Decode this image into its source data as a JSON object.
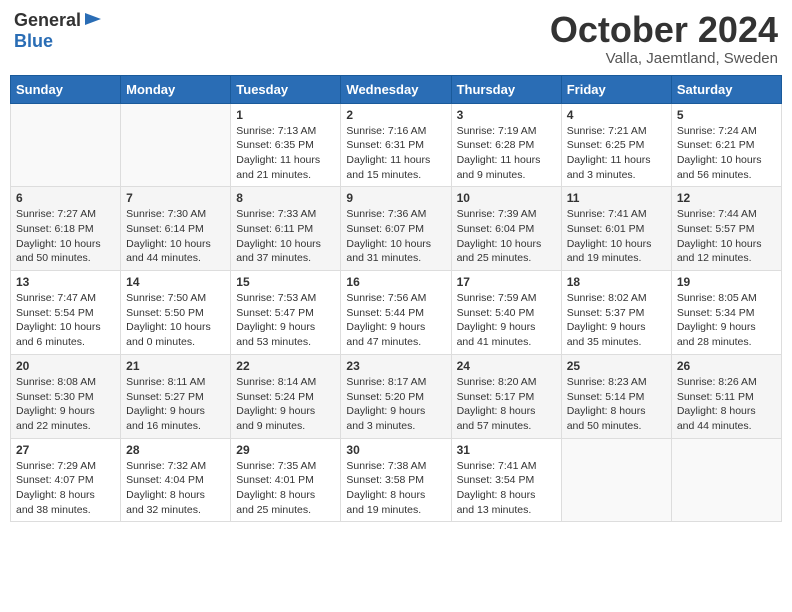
{
  "header": {
    "logo_general": "General",
    "logo_blue": "Blue",
    "month_title": "October 2024",
    "subtitle": "Valla, Jaemtland, Sweden"
  },
  "weekdays": [
    "Sunday",
    "Monday",
    "Tuesday",
    "Wednesday",
    "Thursday",
    "Friday",
    "Saturday"
  ],
  "weeks": [
    [
      {
        "day": "",
        "sunrise": "",
        "sunset": "",
        "daylight": ""
      },
      {
        "day": "",
        "sunrise": "",
        "sunset": "",
        "daylight": ""
      },
      {
        "day": "1",
        "sunrise": "Sunrise: 7:13 AM",
        "sunset": "Sunset: 6:35 PM",
        "daylight": "Daylight: 11 hours and 21 minutes."
      },
      {
        "day": "2",
        "sunrise": "Sunrise: 7:16 AM",
        "sunset": "Sunset: 6:31 PM",
        "daylight": "Daylight: 11 hours and 15 minutes."
      },
      {
        "day": "3",
        "sunrise": "Sunrise: 7:19 AM",
        "sunset": "Sunset: 6:28 PM",
        "daylight": "Daylight: 11 hours and 9 minutes."
      },
      {
        "day": "4",
        "sunrise": "Sunrise: 7:21 AM",
        "sunset": "Sunset: 6:25 PM",
        "daylight": "Daylight: 11 hours and 3 minutes."
      },
      {
        "day": "5",
        "sunrise": "Sunrise: 7:24 AM",
        "sunset": "Sunset: 6:21 PM",
        "daylight": "Daylight: 10 hours and 56 minutes."
      }
    ],
    [
      {
        "day": "6",
        "sunrise": "Sunrise: 7:27 AM",
        "sunset": "Sunset: 6:18 PM",
        "daylight": "Daylight: 10 hours and 50 minutes."
      },
      {
        "day": "7",
        "sunrise": "Sunrise: 7:30 AM",
        "sunset": "Sunset: 6:14 PM",
        "daylight": "Daylight: 10 hours and 44 minutes."
      },
      {
        "day": "8",
        "sunrise": "Sunrise: 7:33 AM",
        "sunset": "Sunset: 6:11 PM",
        "daylight": "Daylight: 10 hours and 37 minutes."
      },
      {
        "day": "9",
        "sunrise": "Sunrise: 7:36 AM",
        "sunset": "Sunset: 6:07 PM",
        "daylight": "Daylight: 10 hours and 31 minutes."
      },
      {
        "day": "10",
        "sunrise": "Sunrise: 7:39 AM",
        "sunset": "Sunset: 6:04 PM",
        "daylight": "Daylight: 10 hours and 25 minutes."
      },
      {
        "day": "11",
        "sunrise": "Sunrise: 7:41 AM",
        "sunset": "Sunset: 6:01 PM",
        "daylight": "Daylight: 10 hours and 19 minutes."
      },
      {
        "day": "12",
        "sunrise": "Sunrise: 7:44 AM",
        "sunset": "Sunset: 5:57 PM",
        "daylight": "Daylight: 10 hours and 12 minutes."
      }
    ],
    [
      {
        "day": "13",
        "sunrise": "Sunrise: 7:47 AM",
        "sunset": "Sunset: 5:54 PM",
        "daylight": "Daylight: 10 hours and 6 minutes."
      },
      {
        "day": "14",
        "sunrise": "Sunrise: 7:50 AM",
        "sunset": "Sunset: 5:50 PM",
        "daylight": "Daylight: 10 hours and 0 minutes."
      },
      {
        "day": "15",
        "sunrise": "Sunrise: 7:53 AM",
        "sunset": "Sunset: 5:47 PM",
        "daylight": "Daylight: 9 hours and 53 minutes."
      },
      {
        "day": "16",
        "sunrise": "Sunrise: 7:56 AM",
        "sunset": "Sunset: 5:44 PM",
        "daylight": "Daylight: 9 hours and 47 minutes."
      },
      {
        "day": "17",
        "sunrise": "Sunrise: 7:59 AM",
        "sunset": "Sunset: 5:40 PM",
        "daylight": "Daylight: 9 hours and 41 minutes."
      },
      {
        "day": "18",
        "sunrise": "Sunrise: 8:02 AM",
        "sunset": "Sunset: 5:37 PM",
        "daylight": "Daylight: 9 hours and 35 minutes."
      },
      {
        "day": "19",
        "sunrise": "Sunrise: 8:05 AM",
        "sunset": "Sunset: 5:34 PM",
        "daylight": "Daylight: 9 hours and 28 minutes."
      }
    ],
    [
      {
        "day": "20",
        "sunrise": "Sunrise: 8:08 AM",
        "sunset": "Sunset: 5:30 PM",
        "daylight": "Daylight: 9 hours and 22 minutes."
      },
      {
        "day": "21",
        "sunrise": "Sunrise: 8:11 AM",
        "sunset": "Sunset: 5:27 PM",
        "daylight": "Daylight: 9 hours and 16 minutes."
      },
      {
        "day": "22",
        "sunrise": "Sunrise: 8:14 AM",
        "sunset": "Sunset: 5:24 PM",
        "daylight": "Daylight: 9 hours and 9 minutes."
      },
      {
        "day": "23",
        "sunrise": "Sunrise: 8:17 AM",
        "sunset": "Sunset: 5:20 PM",
        "daylight": "Daylight: 9 hours and 3 minutes."
      },
      {
        "day": "24",
        "sunrise": "Sunrise: 8:20 AM",
        "sunset": "Sunset: 5:17 PM",
        "daylight": "Daylight: 8 hours and 57 minutes."
      },
      {
        "day": "25",
        "sunrise": "Sunrise: 8:23 AM",
        "sunset": "Sunset: 5:14 PM",
        "daylight": "Daylight: 8 hours and 50 minutes."
      },
      {
        "day": "26",
        "sunrise": "Sunrise: 8:26 AM",
        "sunset": "Sunset: 5:11 PM",
        "daylight": "Daylight: 8 hours and 44 minutes."
      }
    ],
    [
      {
        "day": "27",
        "sunrise": "Sunrise: 7:29 AM",
        "sunset": "Sunset: 4:07 PM",
        "daylight": "Daylight: 8 hours and 38 minutes."
      },
      {
        "day": "28",
        "sunrise": "Sunrise: 7:32 AM",
        "sunset": "Sunset: 4:04 PM",
        "daylight": "Daylight: 8 hours and 32 minutes."
      },
      {
        "day": "29",
        "sunrise": "Sunrise: 7:35 AM",
        "sunset": "Sunset: 4:01 PM",
        "daylight": "Daylight: 8 hours and 25 minutes."
      },
      {
        "day": "30",
        "sunrise": "Sunrise: 7:38 AM",
        "sunset": "Sunset: 3:58 PM",
        "daylight": "Daylight: 8 hours and 19 minutes."
      },
      {
        "day": "31",
        "sunrise": "Sunrise: 7:41 AM",
        "sunset": "Sunset: 3:54 PM",
        "daylight": "Daylight: 8 hours and 13 minutes."
      },
      {
        "day": "",
        "sunrise": "",
        "sunset": "",
        "daylight": ""
      },
      {
        "day": "",
        "sunrise": "",
        "sunset": "",
        "daylight": ""
      }
    ]
  ]
}
